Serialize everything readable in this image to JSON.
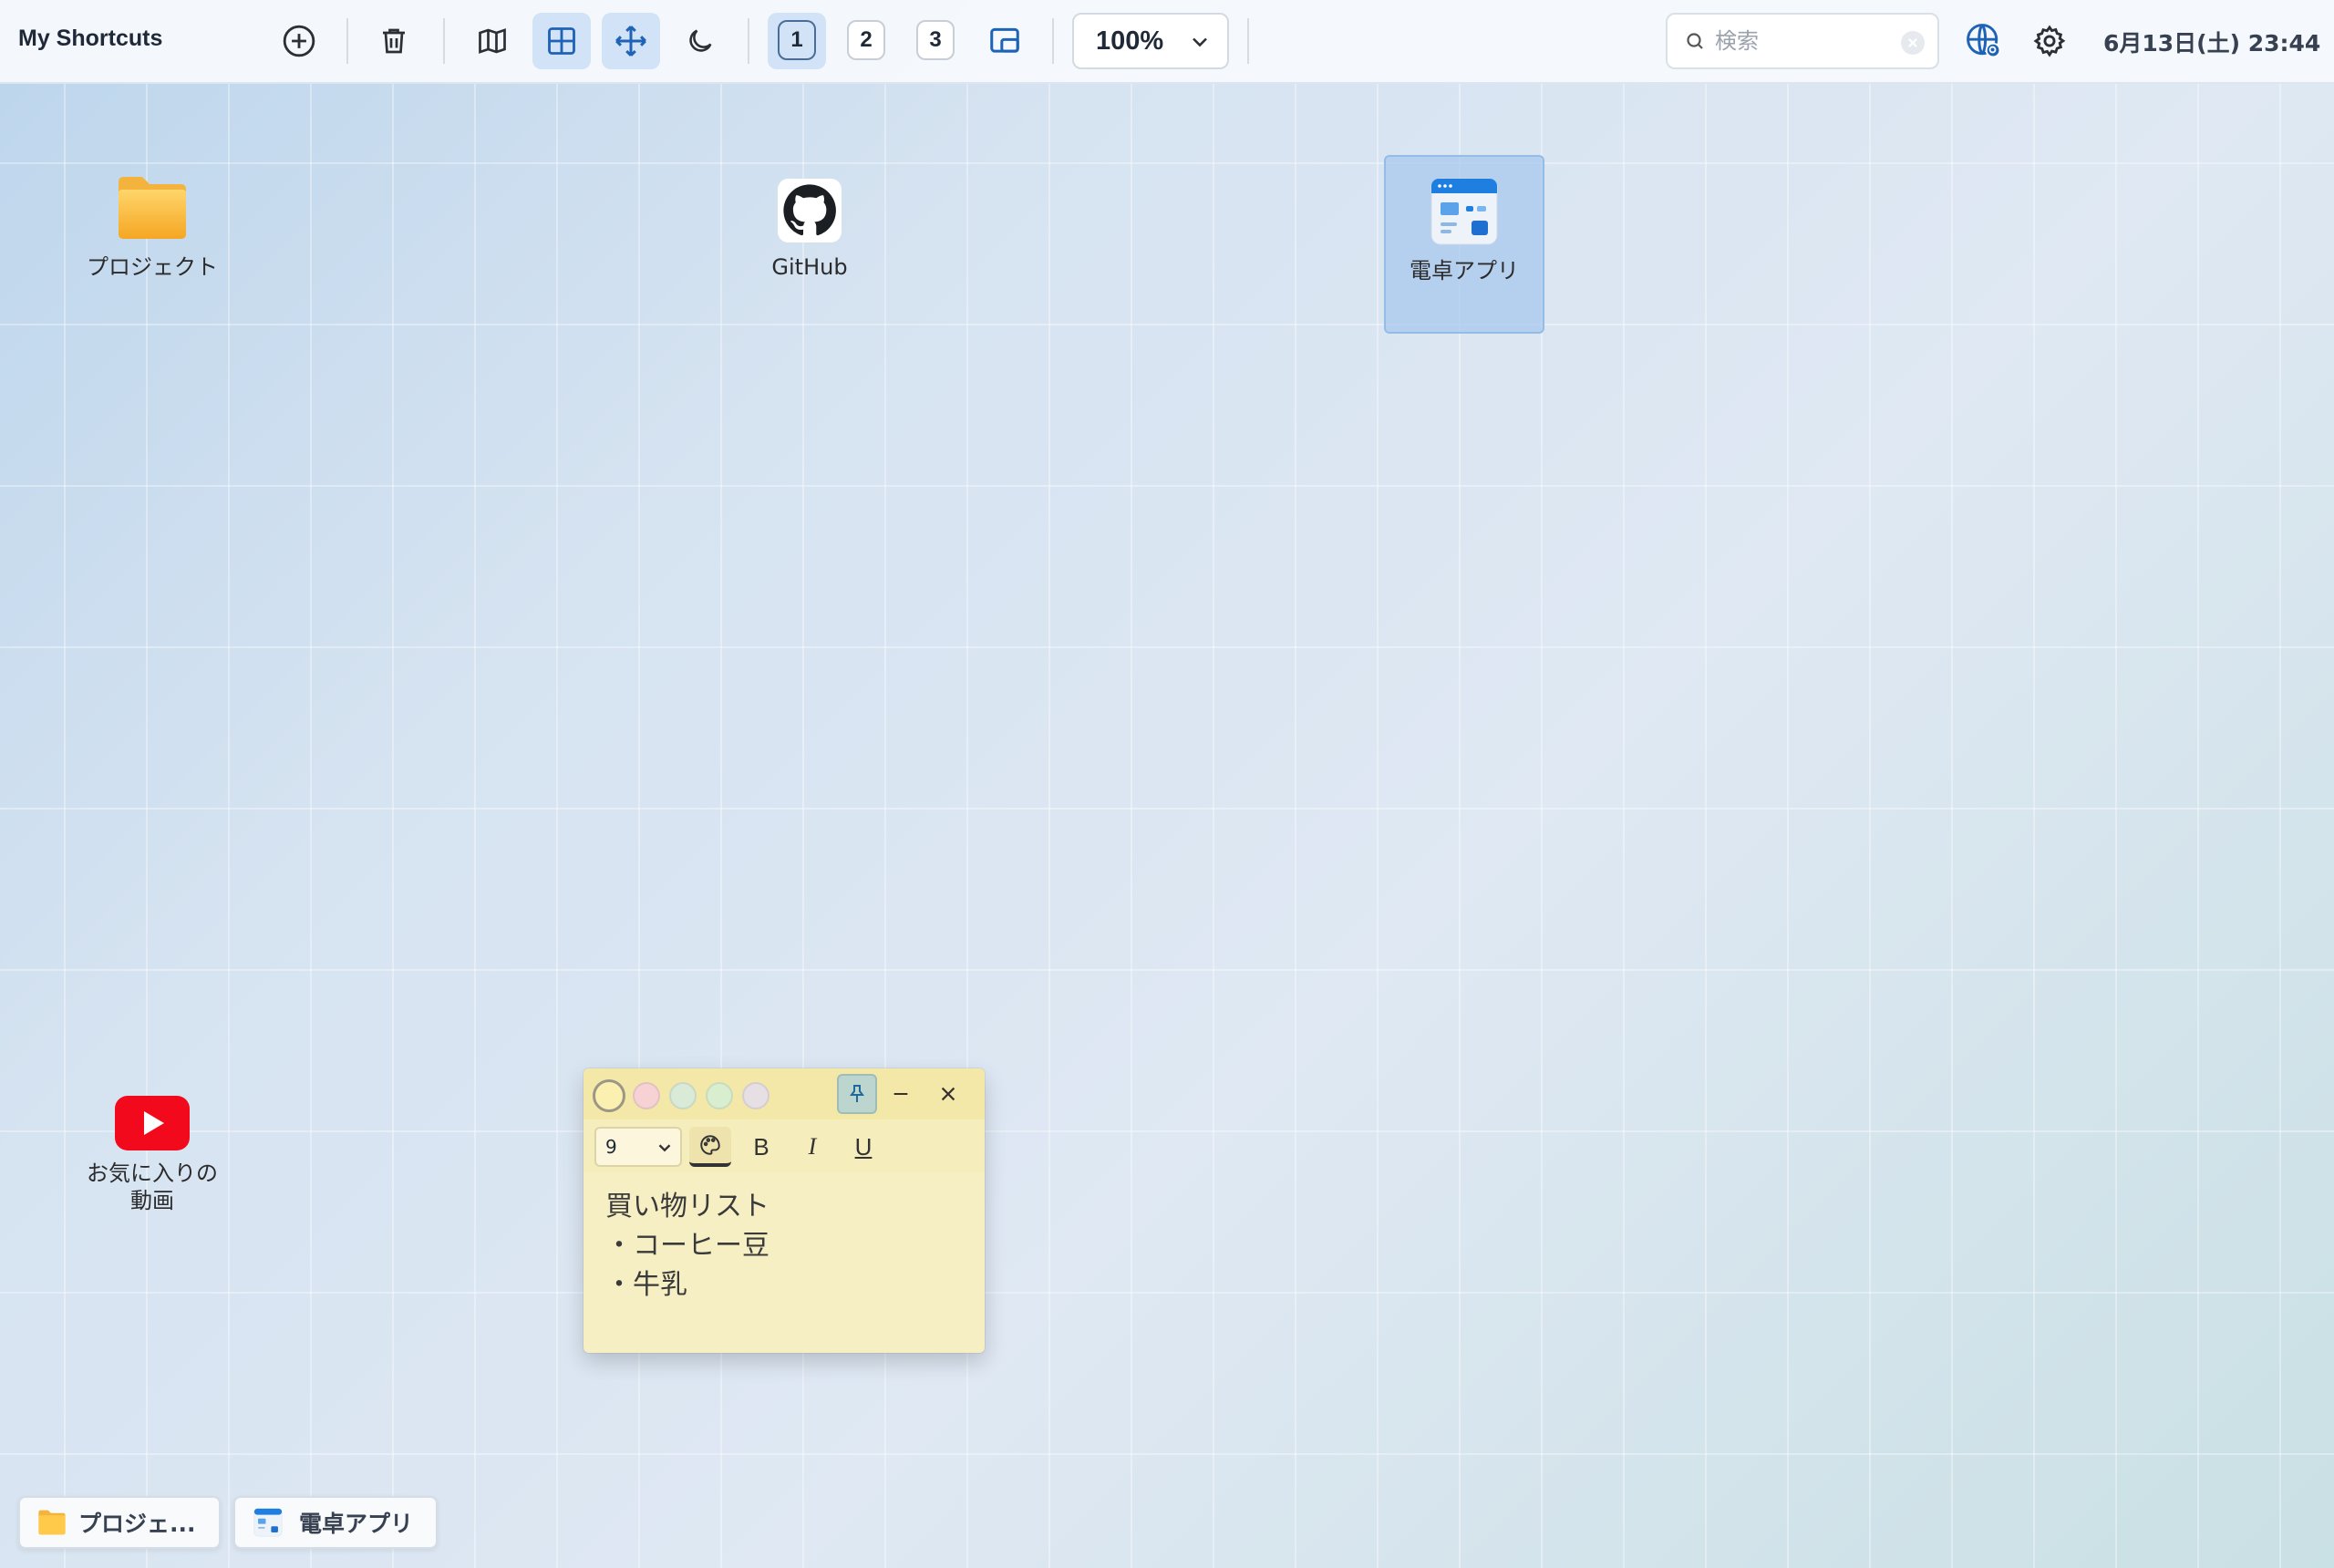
{
  "app": {
    "title": "My Shortcuts"
  },
  "toolbar": {
    "icons": [
      "add-icon",
      "trash-icon",
      "map-icon",
      "grid-icon",
      "move-icon",
      "moon-icon",
      "window-icon"
    ],
    "workspaces": [
      "1",
      "2",
      "3"
    ],
    "active_workspace": "1",
    "zoom": "100%",
    "accent": "#1f63b6"
  },
  "search": {
    "placeholder": "検索",
    "value": ""
  },
  "status": {
    "datetime": "6月13日(土) 23:44"
  },
  "desktop": {
    "shortcuts": [
      {
        "label": "プロジェクト",
        "icon": "folder-icon"
      },
      {
        "label": "GitHub",
        "icon": "github-icon"
      },
      {
        "label": "電卓アプリ",
        "icon": "calculator-app-icon",
        "selected": true
      },
      {
        "label_line1": "お気に入りの",
        "label_line2": "動画",
        "icon": "youtube-icon"
      }
    ]
  },
  "note": {
    "colors": [
      "#fbf0b0",
      "#f6d2d4",
      "#d9ead7",
      "#d9eecf",
      "#e6dfe4"
    ],
    "font_size": "9",
    "bold": "B",
    "italic": "I",
    "underline": "U",
    "lines": [
      "買い物リスト",
      "・コーヒー豆",
      "・牛乳"
    ]
  },
  "taskbar": {
    "items": [
      {
        "label": "プロジェ...",
        "icon": "folder-icon"
      },
      {
        "label": "電卓アプリ",
        "icon": "calculator-app-icon"
      }
    ]
  }
}
